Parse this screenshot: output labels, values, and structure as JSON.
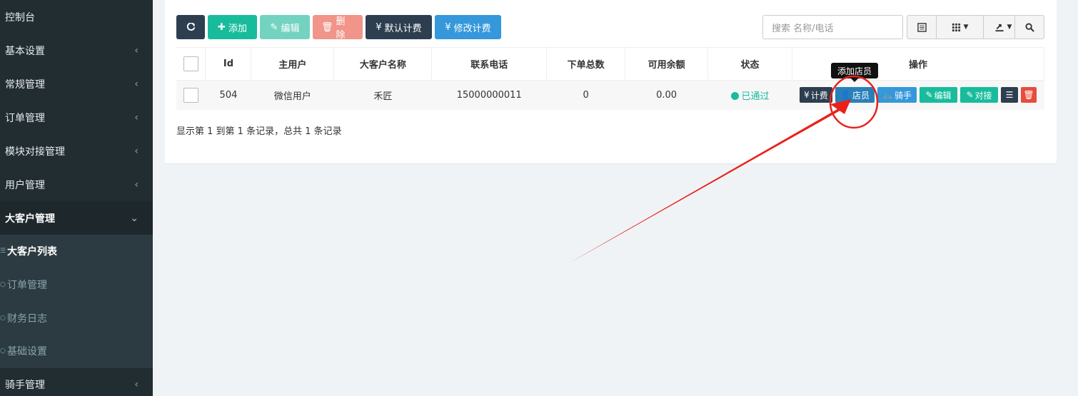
{
  "sidebar": {
    "items": [
      {
        "label": "控制台",
        "chevron": ""
      },
      {
        "label": "基本设置",
        "chevron": "‹"
      },
      {
        "label": "常规管理",
        "chevron": "‹"
      },
      {
        "label": "订单管理",
        "chevron": "‹"
      },
      {
        "label": "模块对接管理",
        "chevron": "‹"
      },
      {
        "label": "用户管理",
        "chevron": "‹"
      },
      {
        "label": "大客户管理",
        "chevron": "⌄"
      }
    ],
    "submenu": [
      {
        "label": "大客户列表"
      },
      {
        "label": "订单管理"
      },
      {
        "label": "财务日志"
      },
      {
        "label": "基础设置"
      }
    ],
    "after": [
      {
        "label": "骑手管理",
        "chevron": "‹"
      }
    ]
  },
  "toolbar": {
    "add_label": "添加",
    "edit_label": "编辑",
    "delete_label": "删除",
    "default_fee_label": "默认计费",
    "modify_fee_label": "修改计费",
    "yen": "¥"
  },
  "search": {
    "placeholder": "搜索 名称/电话"
  },
  "table": {
    "headers": [
      "Id",
      "主用户",
      "大客户名称",
      "联系电话",
      "下单总数",
      "可用余额",
      "状态",
      "操作"
    ],
    "rows": [
      {
        "id": "504",
        "main_user": "微信用户",
        "name": "禾匠",
        "phone": "15000000011",
        "orders": "0",
        "balance": "0.00",
        "status": "已通过"
      }
    ],
    "ops": {
      "fee": "计费",
      "staff": "店员",
      "rider": "骑手",
      "edit": "编辑",
      "dock": "对接"
    }
  },
  "tooltip": "添加店员",
  "records": "显示第 1 到第 1 条记录，总共 1 条记录",
  "colors": {
    "annotation": "#e8221b",
    "primary": "#18bc9c",
    "dark": "#2c3e50"
  }
}
